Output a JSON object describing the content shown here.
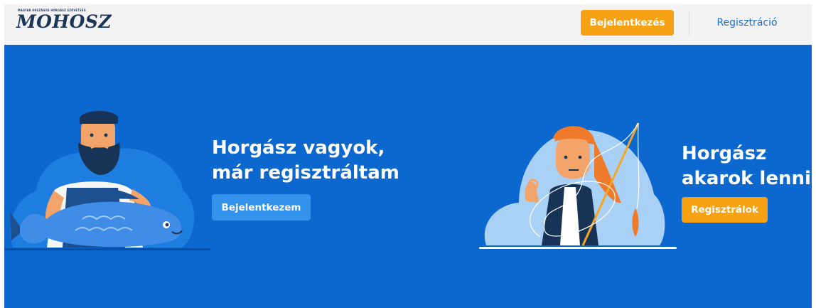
{
  "header": {
    "logo_tagline": "MAGYAR ORSZÁGOS HORGÁSZ SZÖVETSÉG",
    "logo_text": "MOHOSZ",
    "login_label": "Bejelentkezés",
    "register_label": "Regisztráció"
  },
  "hero": {
    "existing": {
      "title_line1": "Horgász vagyok,",
      "title_line2": "már regisztráltam",
      "button_label": "Bejelentkezem",
      "illustration_icon": "bearded-fisherman-holding-fish-illustration"
    },
    "new": {
      "title_line1": "Horgász",
      "title_line2": "akarok lenni",
      "button_label": "Regisztrálok",
      "illustration_icon": "tangled-fisher-woman-illustration"
    }
  },
  "colors": {
    "header_bg": "#f3f3f3",
    "hero_bg": "#0c67ce",
    "accent_orange": "#f7a114",
    "accent_blue": "#3393ec",
    "link_blue": "#1c6fd0",
    "logo_navy": "#1b3558"
  }
}
